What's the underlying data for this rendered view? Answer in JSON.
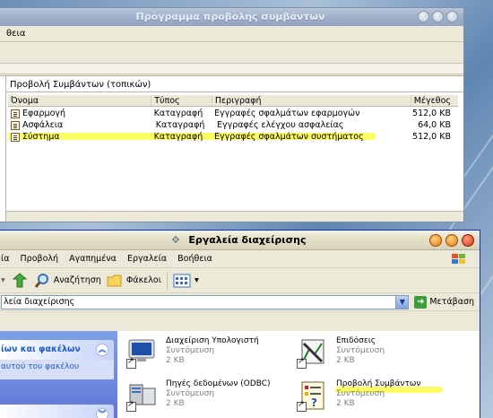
{
  "event_viewer": {
    "title": "Πρόγραμμα προβολής συμβάντων",
    "menu": "θεια",
    "panel_title": "Προβολή Συμβάντων (τοπικών)",
    "columns": [
      "Όνομα",
      "Τύπος",
      "Περιγραφή",
      "Μέγεθος"
    ],
    "rows": [
      {
        "name": "Εφαρμογή",
        "type": "Καταγραφή",
        "desc": "Εγγραφές σφαλμάτων εφαρμογών",
        "size": "512,0 KB",
        "highlighted": false
      },
      {
        "name": "Ασφάλεια",
        "type": "Καταγραφή",
        "desc": "Εγγραφές ελέγχου ασφαλείας",
        "size": "64,0 KB",
        "highlighted": false
      },
      {
        "name": "Σύστημα",
        "type": "Καταγραφή",
        "desc": "Εγγραφές σφαλμάτων συστήματος",
        "size": "512,0 KB",
        "highlighted": true
      }
    ]
  },
  "admin_tools": {
    "title": "Εργαλεία διαχείρισης",
    "menu": [
      "ία",
      "Προβολή",
      "Αγαπημένα",
      "Εργαλεία",
      "Βοήθεια"
    ],
    "toolbar": {
      "search": "Αναζήτηση",
      "folders": "Φάκελοι"
    },
    "address": "λεία διαχείρισης",
    "go_label": "Μετάβαση",
    "tasks": {
      "header1": "ίων και φακέλων",
      "body1": "αυτού του φακέλου"
    },
    "tiles": [
      {
        "name": "Διαχείριση Υπολογιστή",
        "sub": "Συντόμευση",
        "size": "2 KB",
        "icon": "computer-management-icon"
      },
      {
        "name": "Επιδόσεις",
        "sub": "Συντόμευση",
        "size": "2 KB",
        "icon": "performance-icon"
      },
      {
        "name": "Πηγές δεδομένων (ODBC)",
        "sub": "Συντόμευση",
        "size": "2 KB",
        "icon": "odbc-icon"
      },
      {
        "name": "Προβολή Συμβάντων",
        "sub": "Συντόμευση",
        "size": "2 KB",
        "icon": "event-viewer-icon",
        "highlighted": true
      }
    ]
  },
  "colors": {
    "highlight": "#fbfb64",
    "xp_blue": "#215dc6"
  }
}
